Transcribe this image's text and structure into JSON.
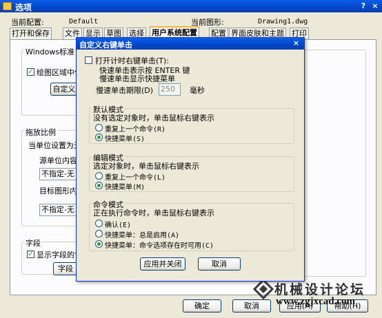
{
  "window": {
    "title": "选项",
    "help": "?",
    "close": "×"
  },
  "config": {
    "current_profile_label": "当前配置:",
    "current_profile_value": "Default",
    "current_drawing_label": "当前图形:",
    "current_drawing_value": "Drawing1.dwg"
  },
  "tabs": [
    "打开和保存",
    "文件",
    "显示",
    "草图",
    "选择",
    "用户系统配置",
    "配置",
    "界面皮肤和主题",
    "打印"
  ],
  "active_tab": "用户系统配置",
  "background_panel": {
    "windows_std_title": "Windows标准",
    "drawing_area_checkbox": "绘图区域中使",
    "custom_button": "自定义",
    "insert_scale_title": "拖放比例",
    "unit_setting": "当单位设置为无",
    "source_units": "源单位内容",
    "source_value": "不指定-无",
    "target_units": "目标图形内",
    "target_value": "不指定-无",
    "fields_title": "字段",
    "show_fields_checkbox": "显示字段的背",
    "fields_button": "字段"
  },
  "footer": {
    "ok": "确定",
    "cancel": "取消",
    "apply": "应用(A)",
    "help": "帮助(H)"
  },
  "dialog": {
    "title": "自定义右键单击",
    "close": "×",
    "timed_checkbox": "打开计时右键单击(T):",
    "timed_line1": "快速单击表示按 ENTER 键",
    "timed_line2": "慢速单击显示快捷菜单",
    "duration_label": "慢速单击期限(D)",
    "duration_value": "250",
    "duration_unit": "毫秒",
    "default_mode": {
      "title": "默认模式",
      "desc": "没有选定对象时，单击鼠标右键表示",
      "options": [
        "重复上一个命令(R)",
        "快捷菜单(S)"
      ],
      "selected": 1
    },
    "edit_mode": {
      "title": "编辑模式",
      "desc": "选定对象时，单击鼠标右键表示",
      "options": [
        "重复上一个命令(L)",
        "快捷菜单(M)"
      ],
      "selected": 1
    },
    "command_mode": {
      "title": "命令模式",
      "desc": "正在执行命令时，单击鼠标右键表示",
      "options": [
        "确认(E)",
        "快捷菜单：总是启用(A)",
        "快捷菜单：命令选项存在时可用(C)"
      ],
      "selected": 2
    },
    "apply_close": "应用并关闭",
    "cancel": "取消"
  },
  "watermark": {
    "text": "机械设计论坛",
    "url": "www.zgjxcad.com"
  },
  "colors": {
    "titlebar": "#0247c9",
    "tab_accent": "#f8b33c",
    "checkmark": "#21a121",
    "watermark": "#3a3a3a"
  }
}
